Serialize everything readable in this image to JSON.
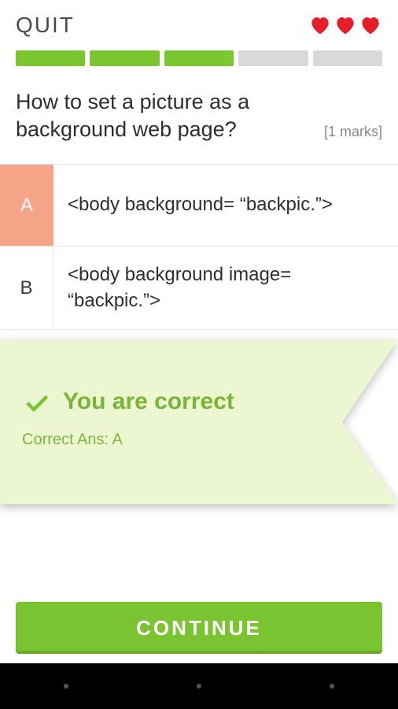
{
  "header": {
    "quit_label": "QUIT",
    "hearts_total": 3
  },
  "progress": {
    "filled": 3,
    "total": 5
  },
  "question": {
    "text": "How to set a picture as a background web page?",
    "marks_label": "[1 marks]"
  },
  "options": [
    {
      "key": "A",
      "text": "<body background= “backpic.”>",
      "selected": true
    },
    {
      "key": "B",
      "text": "<body background image= “backpic.”>",
      "selected": false
    }
  ],
  "feedback": {
    "title": "You are correct",
    "subtitle": "Correct Ans: A"
  },
  "footer": {
    "continue_label": "CONTINUE"
  },
  "colors": {
    "accent_green": "#79c430",
    "heart_red": "#e61e27",
    "selected_bg": "#f7a588",
    "feedback_bg": "#ecf6d1"
  }
}
